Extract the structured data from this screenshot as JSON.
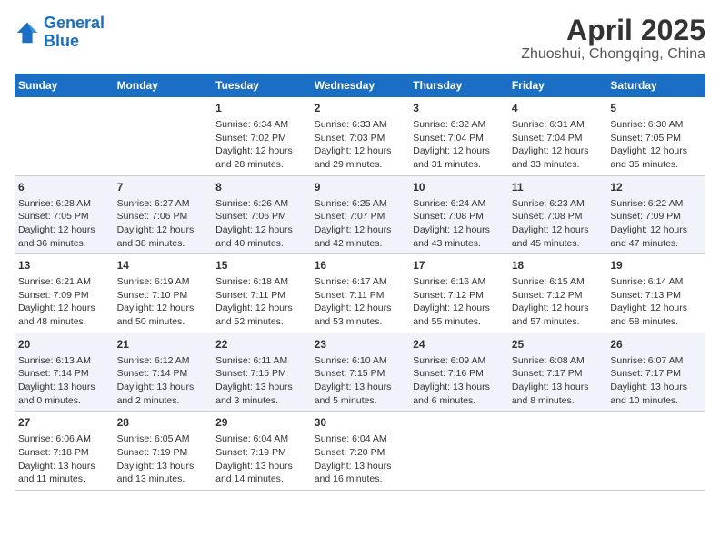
{
  "logo": {
    "text_general": "General",
    "text_blue": "Blue"
  },
  "title": "April 2025",
  "subtitle": "Zhuoshui, Chongqing, China",
  "weekdays": [
    "Sunday",
    "Monday",
    "Tuesday",
    "Wednesday",
    "Thursday",
    "Friday",
    "Saturday"
  ],
  "weeks": [
    [
      {
        "num": "",
        "info": ""
      },
      {
        "num": "",
        "info": ""
      },
      {
        "num": "1",
        "info": "Sunrise: 6:34 AM\nSunset: 7:02 PM\nDaylight: 12 hours and 28 minutes."
      },
      {
        "num": "2",
        "info": "Sunrise: 6:33 AM\nSunset: 7:03 PM\nDaylight: 12 hours and 29 minutes."
      },
      {
        "num": "3",
        "info": "Sunrise: 6:32 AM\nSunset: 7:04 PM\nDaylight: 12 hours and 31 minutes."
      },
      {
        "num": "4",
        "info": "Sunrise: 6:31 AM\nSunset: 7:04 PM\nDaylight: 12 hours and 33 minutes."
      },
      {
        "num": "5",
        "info": "Sunrise: 6:30 AM\nSunset: 7:05 PM\nDaylight: 12 hours and 35 minutes."
      }
    ],
    [
      {
        "num": "6",
        "info": "Sunrise: 6:28 AM\nSunset: 7:05 PM\nDaylight: 12 hours and 36 minutes."
      },
      {
        "num": "7",
        "info": "Sunrise: 6:27 AM\nSunset: 7:06 PM\nDaylight: 12 hours and 38 minutes."
      },
      {
        "num": "8",
        "info": "Sunrise: 6:26 AM\nSunset: 7:06 PM\nDaylight: 12 hours and 40 minutes."
      },
      {
        "num": "9",
        "info": "Sunrise: 6:25 AM\nSunset: 7:07 PM\nDaylight: 12 hours and 42 minutes."
      },
      {
        "num": "10",
        "info": "Sunrise: 6:24 AM\nSunset: 7:08 PM\nDaylight: 12 hours and 43 minutes."
      },
      {
        "num": "11",
        "info": "Sunrise: 6:23 AM\nSunset: 7:08 PM\nDaylight: 12 hours and 45 minutes."
      },
      {
        "num": "12",
        "info": "Sunrise: 6:22 AM\nSunset: 7:09 PM\nDaylight: 12 hours and 47 minutes."
      }
    ],
    [
      {
        "num": "13",
        "info": "Sunrise: 6:21 AM\nSunset: 7:09 PM\nDaylight: 12 hours and 48 minutes."
      },
      {
        "num": "14",
        "info": "Sunrise: 6:19 AM\nSunset: 7:10 PM\nDaylight: 12 hours and 50 minutes."
      },
      {
        "num": "15",
        "info": "Sunrise: 6:18 AM\nSunset: 7:11 PM\nDaylight: 12 hours and 52 minutes."
      },
      {
        "num": "16",
        "info": "Sunrise: 6:17 AM\nSunset: 7:11 PM\nDaylight: 12 hours and 53 minutes."
      },
      {
        "num": "17",
        "info": "Sunrise: 6:16 AM\nSunset: 7:12 PM\nDaylight: 12 hours and 55 minutes."
      },
      {
        "num": "18",
        "info": "Sunrise: 6:15 AM\nSunset: 7:12 PM\nDaylight: 12 hours and 57 minutes."
      },
      {
        "num": "19",
        "info": "Sunrise: 6:14 AM\nSunset: 7:13 PM\nDaylight: 12 hours and 58 minutes."
      }
    ],
    [
      {
        "num": "20",
        "info": "Sunrise: 6:13 AM\nSunset: 7:14 PM\nDaylight: 13 hours and 0 minutes."
      },
      {
        "num": "21",
        "info": "Sunrise: 6:12 AM\nSunset: 7:14 PM\nDaylight: 13 hours and 2 minutes."
      },
      {
        "num": "22",
        "info": "Sunrise: 6:11 AM\nSunset: 7:15 PM\nDaylight: 13 hours and 3 minutes."
      },
      {
        "num": "23",
        "info": "Sunrise: 6:10 AM\nSunset: 7:15 PM\nDaylight: 13 hours and 5 minutes."
      },
      {
        "num": "24",
        "info": "Sunrise: 6:09 AM\nSunset: 7:16 PM\nDaylight: 13 hours and 6 minutes."
      },
      {
        "num": "25",
        "info": "Sunrise: 6:08 AM\nSunset: 7:17 PM\nDaylight: 13 hours and 8 minutes."
      },
      {
        "num": "26",
        "info": "Sunrise: 6:07 AM\nSunset: 7:17 PM\nDaylight: 13 hours and 10 minutes."
      }
    ],
    [
      {
        "num": "27",
        "info": "Sunrise: 6:06 AM\nSunset: 7:18 PM\nDaylight: 13 hours and 11 minutes."
      },
      {
        "num": "28",
        "info": "Sunrise: 6:05 AM\nSunset: 7:19 PM\nDaylight: 13 hours and 13 minutes."
      },
      {
        "num": "29",
        "info": "Sunrise: 6:04 AM\nSunset: 7:19 PM\nDaylight: 13 hours and 14 minutes."
      },
      {
        "num": "30",
        "info": "Sunrise: 6:04 AM\nSunset: 7:20 PM\nDaylight: 13 hours and 16 minutes."
      },
      {
        "num": "",
        "info": ""
      },
      {
        "num": "",
        "info": ""
      },
      {
        "num": "",
        "info": ""
      }
    ]
  ]
}
